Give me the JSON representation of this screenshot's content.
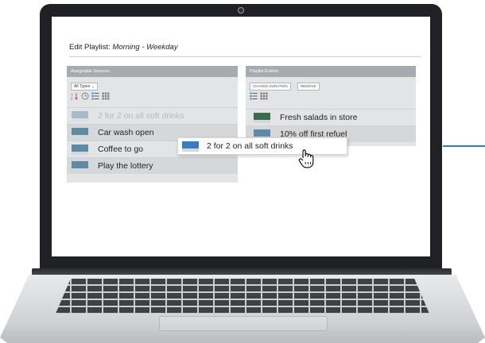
{
  "header": {
    "title_prefix": "Edit Playlist:",
    "playlist_name": "Morning - Weekday"
  },
  "assignable": {
    "title": "Assignable Sources",
    "type_filter": "All Types",
    "items": [
      {
        "label": "2 for 2 on all soft drinks",
        "state": "dragging-placeholder"
      },
      {
        "label": "Car wash open"
      },
      {
        "label": "Coffee to go"
      },
      {
        "label": "Play the lottery"
      }
    ]
  },
  "playlist": {
    "title": "Playlist Entries",
    "actions": {
      "change_duration": "CHANGE DURATION",
      "remove": "REMOVE"
    },
    "entries": [
      {
        "label": "Fresh salads in store"
      },
      {
        "label": "10% off first refuel"
      }
    ]
  },
  "drag": {
    "label": "2 for 2 on all soft drinks"
  },
  "icons": {
    "sort": "sort-az-icon",
    "history": "clock-icon",
    "list_view": "list-view-icon",
    "grid_view": "grid-view-icon",
    "cursor": "hand-pointer-icon"
  },
  "colors": {
    "accent": "#2e7eb8",
    "panel_header": "#a7abaf",
    "panel_bg": "#e3e4e5"
  }
}
